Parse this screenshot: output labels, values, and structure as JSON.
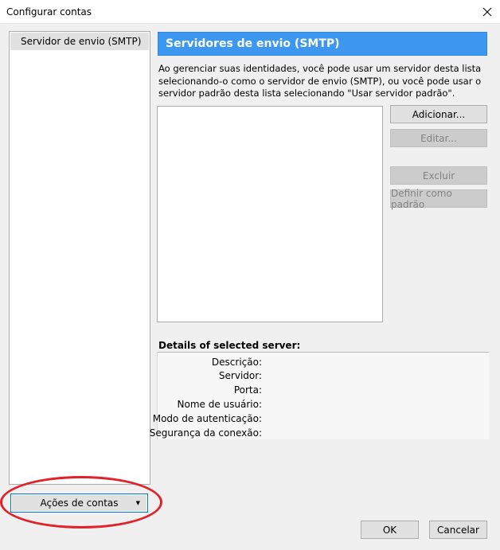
{
  "window": {
    "title": "Configurar contas",
    "close_icon": "close-icon"
  },
  "sidebar": {
    "items": [
      {
        "label": "Servidor de envio (SMTP)",
        "selected": true
      }
    ],
    "actions_button": {
      "label": "Ações de contas",
      "icon": "chevron-down-icon"
    }
  },
  "annotation": {
    "color": "#e0232a",
    "shape": "ellipse"
  },
  "main": {
    "header": "Servidores de envio (SMTP)",
    "header_color": "#3c97f0",
    "description": "Ao gerenciar suas identidades, você pode usar um servidor desta lista selecionando-o como o servidor de envio (SMTP), ou você pode usar o servidor padrão desta lista selecionando \"Usar servidor padrão\".",
    "server_list": [],
    "buttons": {
      "add": "Adicionar...",
      "edit": "Editar...",
      "delete": "Excluir",
      "set_default": "Definir como padrão"
    },
    "details": {
      "title": "Details of selected server:",
      "fields": {
        "description": "Descrição:",
        "server": "Servidor:",
        "port": "Porta:",
        "username": "Nome de usuário:",
        "auth_mode": "Modo de autenticação:",
        "security": "Segurança da conexão:"
      }
    }
  },
  "footer": {
    "ok": "OK",
    "cancel": "Cancelar"
  }
}
